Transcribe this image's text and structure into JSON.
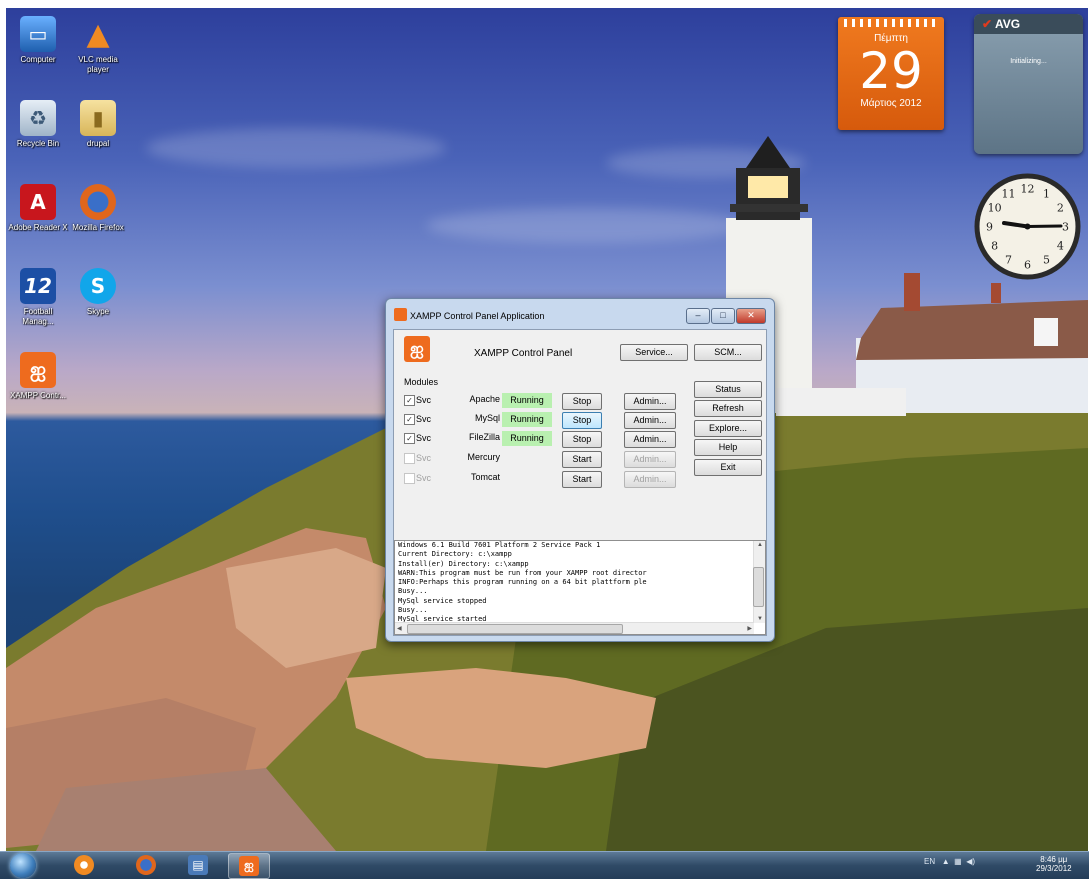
{
  "desktop_icons": [
    {
      "label": "Computer",
      "icon": "computer-icon"
    },
    {
      "label": "VLC media player",
      "icon": "vlc-cone-icon"
    },
    {
      "label": "Recycle Bin",
      "icon": "recycle-bin-icon"
    },
    {
      "label": "drupal",
      "icon": "folder-icon"
    },
    {
      "label": "Adobe Reader X",
      "icon": "adobe-reader-icon"
    },
    {
      "label": "Mozilla Firefox",
      "icon": "firefox-icon"
    },
    {
      "label": "Football Manag...",
      "icon": "fm12-icon"
    },
    {
      "label": "Skype",
      "icon": "skype-icon"
    },
    {
      "label": "XAMPP Contr...",
      "icon": "xampp-icon"
    }
  ],
  "calendar_gadget": {
    "weekday": "Πέμπτη",
    "day": "29",
    "month_year": "Μάρτιος 2012"
  },
  "avg_gadget": {
    "title": "AVG",
    "status": "Initializing..."
  },
  "clock_gadget": {
    "numbers": [
      "12",
      "1",
      "2",
      "3",
      "4",
      "5",
      "6",
      "7",
      "8",
      "9",
      "10",
      "11"
    ]
  },
  "xampp": {
    "window_title": "XAMPP Control Panel Application",
    "heading": "XAMPP Control Panel",
    "service_button": "Service...",
    "scm_button": "SCM...",
    "modules_label": "Modules",
    "svc_label": "Svc",
    "side_buttons": [
      "Status",
      "Refresh",
      "Explore...",
      "Help",
      "Exit"
    ],
    "modules": [
      {
        "name": "Apache",
        "checked": true,
        "status": "Running",
        "action": "Stop",
        "admin": "Admin...",
        "enabled": true
      },
      {
        "name": "MySql",
        "checked": true,
        "status": "Running",
        "action": "Stop",
        "admin": "Admin...",
        "enabled": true
      },
      {
        "name": "FileZilla",
        "checked": true,
        "status": "Running",
        "action": "Stop",
        "admin": "Admin...",
        "enabled": true
      },
      {
        "name": "Mercury",
        "checked": false,
        "status": "",
        "action": "Start",
        "admin": "Admin...",
        "enabled": false
      },
      {
        "name": "Tomcat",
        "checked": false,
        "status": "",
        "action": "Start",
        "admin": "Admin...",
        "enabled": false
      }
    ],
    "log_lines": [
      "Windows 6.1 Build 7601 Platform 2 Service Pack 1",
      "Current Directory: c:\\xampp",
      "Install(er) Directory: c:\\xampp",
      "WARN:This program must be run from your XAMPP root director",
      "INFO:Perhaps this program running on a 64 bit plattform ple",
      "Busy...",
      "MySql service stopped",
      "Busy...",
      "MySql service started"
    ]
  },
  "taskbar": {
    "items": [
      {
        "icon": "media-player-icon",
        "color": "#f08a22"
      },
      {
        "icon": "firefox-icon",
        "color": "#e0661c"
      },
      {
        "icon": "window-switcher-icon",
        "color": "#4a7ab8"
      },
      {
        "icon": "xampp-icon",
        "color": "#ee6b1e"
      }
    ],
    "tray_lang": "EN",
    "time": "8:46 μμ",
    "date": "29/3/2012"
  }
}
